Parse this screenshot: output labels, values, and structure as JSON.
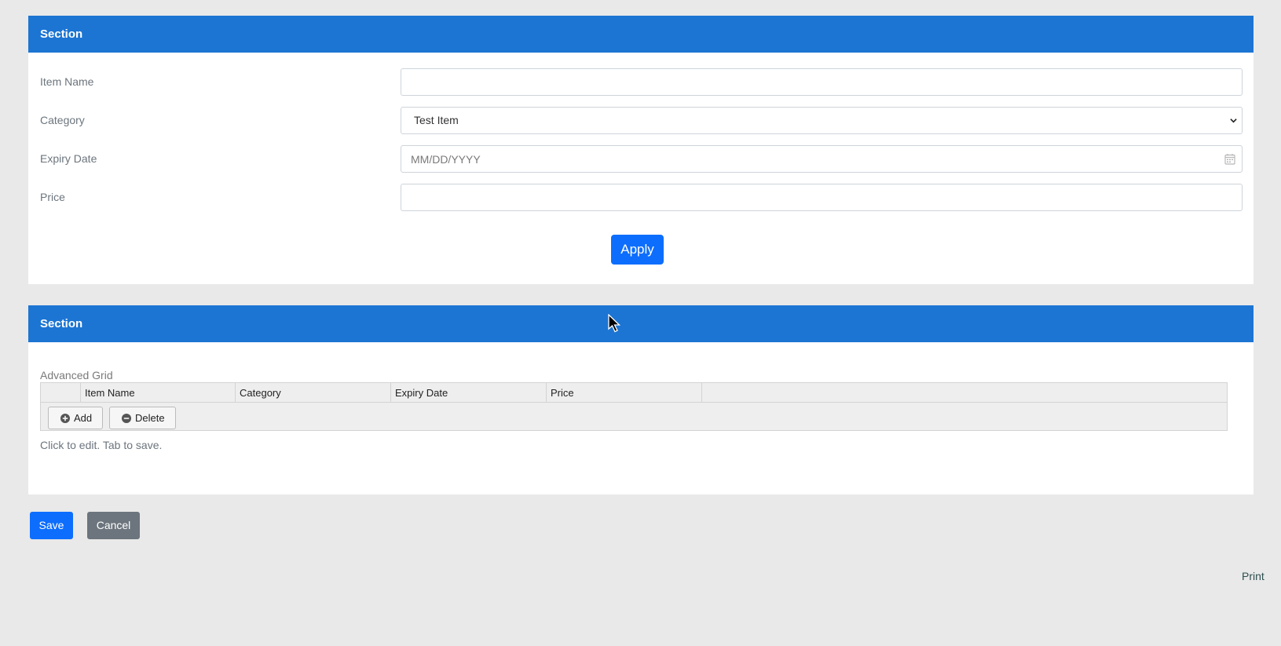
{
  "sections": {
    "top_title": "Section",
    "bottom_title": "Section"
  },
  "form": {
    "item_name_label": "Item Name",
    "item_name_value": "",
    "category_label": "Category",
    "category_value": "Test Item",
    "expiry_label": "Expiry Date",
    "expiry_placeholder": "MM/DD/YYYY",
    "price_label": "Price",
    "price_value": "",
    "apply_label": "Apply"
  },
  "grid": {
    "title": "Advanced Grid",
    "columns": [
      "",
      "Item Name",
      "Category",
      "Expiry Date",
      "Price",
      ""
    ],
    "add_label": "Add",
    "delete_label": "Delete",
    "help_text": "Click to edit. Tab to save."
  },
  "footer": {
    "save_label": "Save",
    "cancel_label": "Cancel",
    "print_label": "Print"
  },
  "colors": {
    "header_blue": "#1c75d3",
    "primary": "#0d6efd",
    "secondary": "#6c757d",
    "background": "#e9e9e9"
  },
  "icons": [
    "calendar-icon",
    "chevron-down-icon",
    "plus-circle-icon",
    "minus-circle-icon",
    "mouse-cursor-icon"
  ]
}
